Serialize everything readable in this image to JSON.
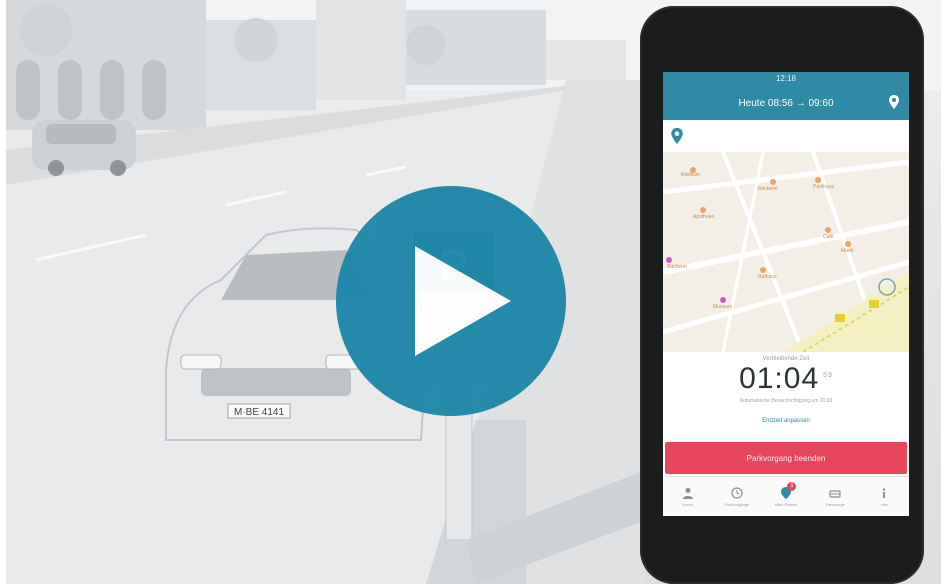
{
  "video": {
    "play_label": "Play video"
  },
  "scene": {
    "license_plate": "M·BE 4141",
    "parking_sign": "P"
  },
  "app": {
    "status_time": "12:18",
    "header_title": "Heute 08:56 → 09:60",
    "search_placeholder": "",
    "map_pois": [
      "Klinikum",
      "Bäckerei",
      "Parkhaus",
      "Apotheke",
      "Café",
      "Rathaus",
      "Museum",
      "Bücherei",
      "Markt"
    ],
    "timer_label": "Verbleibende Zeit",
    "timer_value": "01:04",
    "timer_suffix": "59",
    "timer_sub": "Automatische Benachrichtigung um 10:03",
    "extend_label": "Endzeit anpassen",
    "end_button": "Parkvorgang beenden",
    "tabs": [
      {
        "label": "Konto",
        "icon": "person-icon"
      },
      {
        "label": "Parkvorgänge",
        "icon": "clock-icon"
      },
      {
        "label": "Mein Parken",
        "icon": "pin-icon",
        "badge": "1"
      },
      {
        "label": "Fahrzeuge",
        "icon": "car-icon"
      },
      {
        "label": "Info",
        "icon": "info-icon"
      }
    ]
  },
  "colors": {
    "accent": "#1e86a8",
    "app_header": "#2f8aa6",
    "end_button": "#e5465c"
  }
}
